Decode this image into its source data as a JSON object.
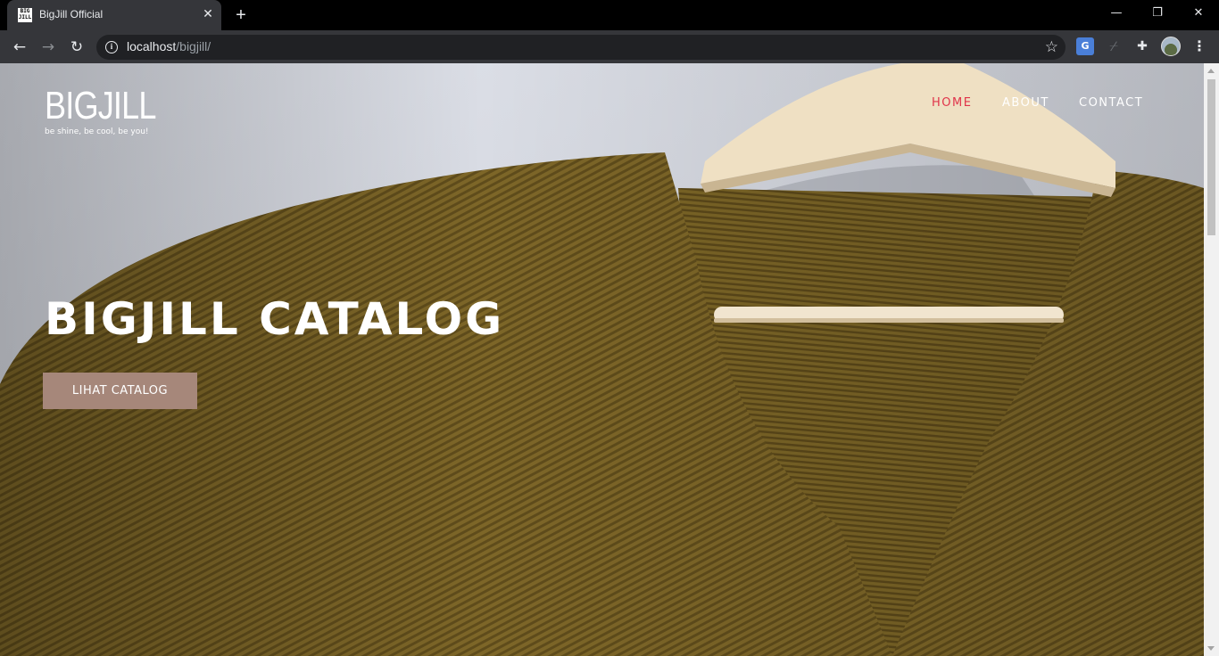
{
  "browser": {
    "tab_title": "BigJill Official",
    "tab_close": "✕",
    "new_tab": "+",
    "favicon_text": "BIG JILL",
    "minimize": "—",
    "restore": "❐",
    "close": "✕",
    "back": "←",
    "forward": "→",
    "reload": "↻",
    "info": "i",
    "url_host": "localhost",
    "url_path": "/bigjill/",
    "bookmark": "☆",
    "ext_translate": "G",
    "ext_disabled": "⌿",
    "ext_puzzle": "✚",
    "menu": "⋮"
  },
  "site": {
    "logo_word": "BIGJILL",
    "logo_tagline": "be shine, be cool, be you!",
    "nav": [
      {
        "label": "HOME",
        "active": true
      },
      {
        "label": "ABOUT",
        "active": false
      },
      {
        "label": "CONTACT",
        "active": false
      }
    ],
    "hero_title": "BIGJILL CATALOG",
    "hero_button": "LIHAT CATALOG"
  },
  "colors": {
    "accent_nav": "#e0344a",
    "button_bg": "#a6877a",
    "sweater": "#7a6427"
  }
}
